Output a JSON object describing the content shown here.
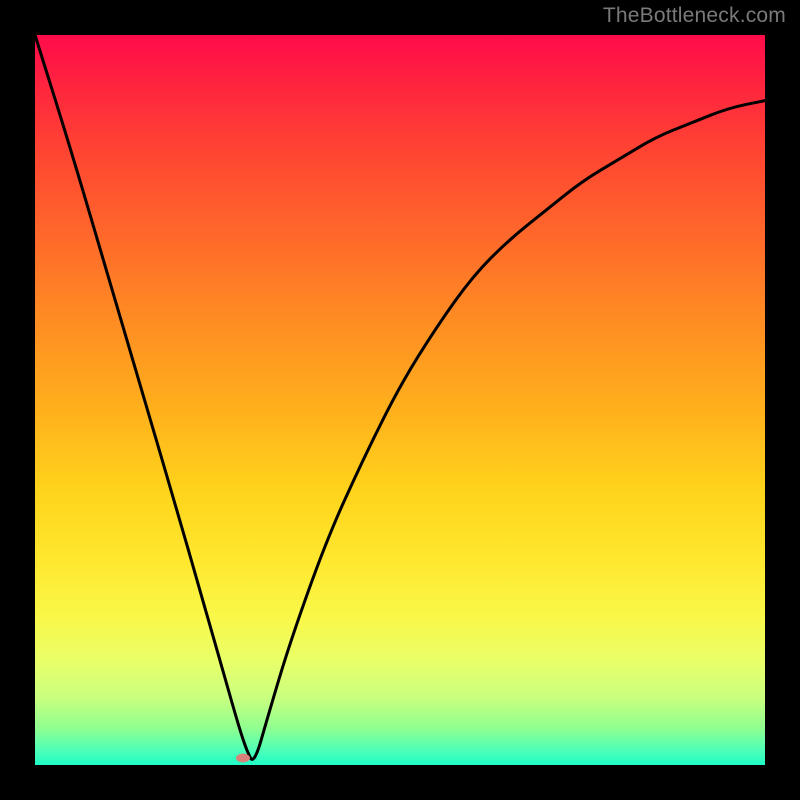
{
  "watermark": "TheBottleneck.com",
  "colors": {
    "frame": "#000000",
    "gradient_top": "#ff0b4a",
    "gradient_bottom": "#1ffdc6",
    "curve": "#000000",
    "marker": "#d7817a"
  },
  "chart_data": {
    "type": "line",
    "title": "",
    "xlabel": "",
    "ylabel": "",
    "xlim": [
      0,
      100
    ],
    "ylim": [
      0,
      100
    ],
    "grid": false,
    "legend": false,
    "series": [
      {
        "name": "curve",
        "x": [
          0,
          5,
          10,
          15,
          20,
          22,
          24,
          26,
          28,
          29,
          30,
          32,
          35,
          40,
          45,
          50,
          55,
          60,
          65,
          70,
          75,
          80,
          85,
          90,
          95,
          100
        ],
        "values": [
          100,
          84,
          67,
          50,
          33,
          26,
          19,
          12,
          5,
          2,
          0,
          7,
          17,
          31,
          42,
          52,
          60,
          67,
          72,
          76,
          80,
          83,
          86,
          88,
          90,
          91
        ]
      }
    ],
    "marker": {
      "x": 28.5,
      "y": 1
    }
  }
}
